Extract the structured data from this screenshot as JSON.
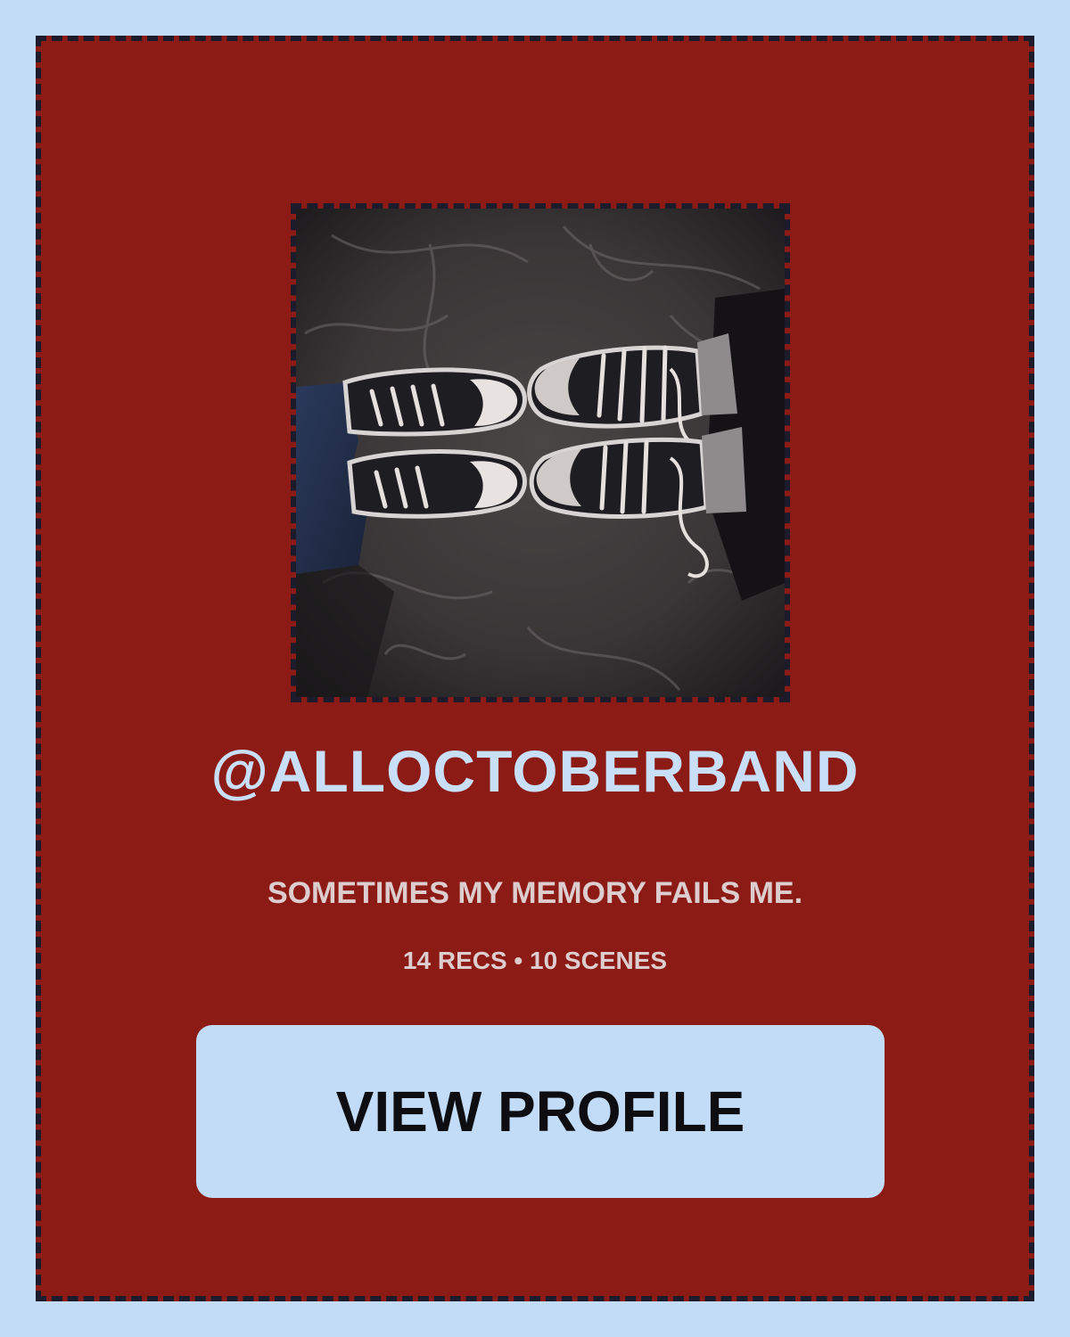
{
  "profile": {
    "username": "@ALLOCTOBERBAND",
    "bio": "SOMETIMES MY MEMORY FAILS ME.",
    "stats": "14 RECS • 10 SCENES",
    "view_button_label": "VIEW PROFILE"
  },
  "colors": {
    "page_background": "#c2dcf7",
    "card_background": "#8c1b16",
    "dashed_border": "#1b1b2c",
    "username_text": "#c9def7",
    "secondary_text": "#ddcdce",
    "button_background": "#c2dcf7",
    "button_text": "#0d0d12"
  }
}
